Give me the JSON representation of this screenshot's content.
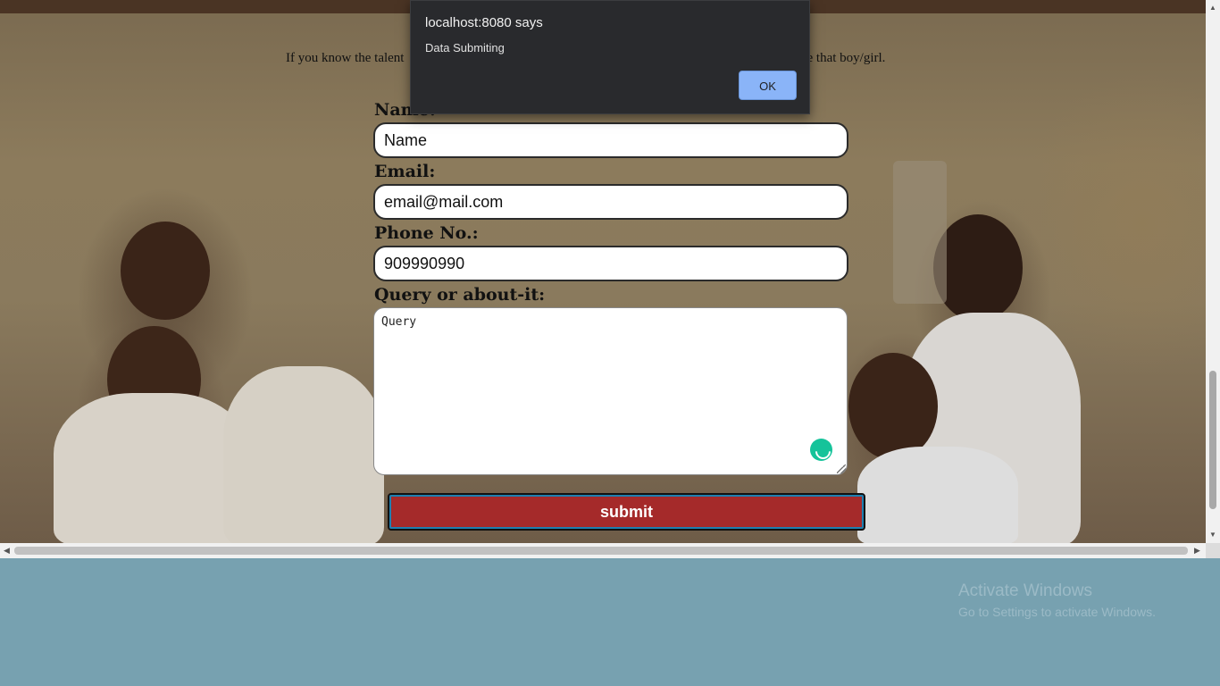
{
  "intro": {
    "text_left": "If you know the talent",
    "text_right": "shape that boy/girl."
  },
  "form": {
    "name_label": "Name:",
    "name_value": "Name",
    "email_label": "Email:",
    "email_value": "email@mail.com",
    "phone_label": "Phone No.:",
    "phone_value": "909990990",
    "query_label": "Query or about-it:",
    "query_value": "Query",
    "submit_label": "submit"
  },
  "dialog": {
    "title": "localhost:8080 says",
    "message": "Data Submiting",
    "ok_label": "OK"
  },
  "watermark": {
    "title": "Activate Windows",
    "subtitle": "Go to Settings to activate Windows."
  },
  "colors": {
    "submit_bg": "#a52a2a",
    "dialog_bg": "#292a2d",
    "ok_bg": "#8ab4f8",
    "desktop_bg": "#77a1b0"
  }
}
